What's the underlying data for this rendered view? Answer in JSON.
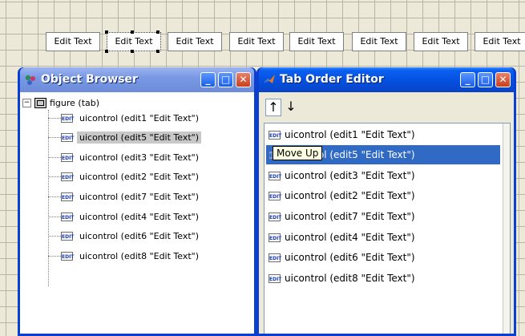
{
  "canvas": {
    "edit_boxes": [
      "Edit Text",
      "Edit Text",
      "Edit Text",
      "Edit Text",
      "Edit Text",
      "Edit Text",
      "Edit Text",
      "Edit Text"
    ],
    "selected_index": 1
  },
  "object_browser": {
    "title": "Object Browser",
    "root": {
      "expander": "−",
      "label": "figure (tab)"
    },
    "icon_text": "EDIT",
    "items": [
      "uicontrol (edit1 \"Edit Text\")",
      "uicontrol (edit5 \"Edit Text\")",
      "uicontrol (edit3 \"Edit Text\")",
      "uicontrol (edit2 \"Edit Text\")",
      "uicontrol (edit7 \"Edit Text\")",
      "uicontrol (edit4 \"Edit Text\")",
      "uicontrol (edit6 \"Edit Text\")",
      "uicontrol (edit8 \"Edit Text\")"
    ],
    "selected_index": 1
  },
  "tab_order_editor": {
    "title": "Tab Order Editor",
    "move_up_glyph": "↑",
    "move_down_glyph": "↓",
    "tooltip": "Move Up",
    "items": [
      "uicontrol (edit1 \"Edit Text\")",
      "uicontrol (edit5 \"Edit Text\")",
      "uicontrol (edit3 \"Edit Text\")",
      "uicontrol (edit2 \"Edit Text\")",
      "uicontrol (edit7 \"Edit Text\")",
      "uicontrol (edit4 \"Edit Text\")",
      "uicontrol (edit6 \"Edit Text\")",
      "uicontrol (edit8 \"Edit Text\")"
    ],
    "selected_index": 1
  },
  "window_controls": {
    "minimize": "_",
    "maximize": "□",
    "close": "✕"
  },
  "colors": {
    "titlebar_active": "#0a5ff0",
    "selection": "#316ac5",
    "tooltip_bg": "#ffffe1"
  }
}
